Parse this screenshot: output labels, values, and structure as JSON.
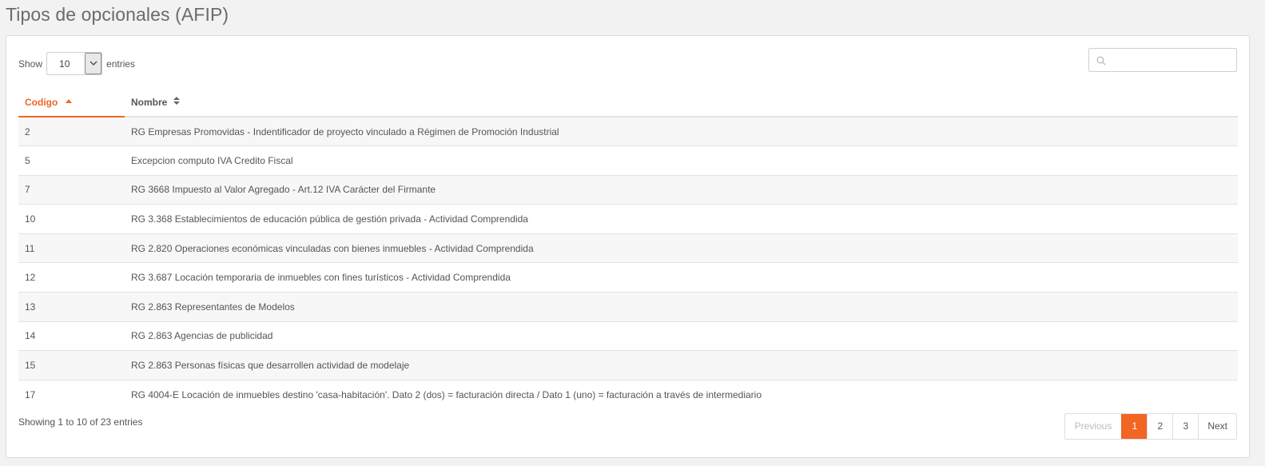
{
  "page": {
    "title": "Tipos de opcionales (AFIP)"
  },
  "length": {
    "show_label": "Show",
    "value": "10",
    "entries_label": "entries"
  },
  "search": {
    "placeholder": ""
  },
  "table": {
    "columns": [
      "Codigo",
      "Nombre"
    ],
    "rows": [
      {
        "codigo": "2",
        "nombre": "RG Empresas Promovidas - Indentificador de proyecto vinculado a Régimen de Promoción Industrial"
      },
      {
        "codigo": "5",
        "nombre": "Excepcion computo IVA Credito Fiscal"
      },
      {
        "codigo": "7",
        "nombre": "RG 3668 Impuesto al Valor Agregado - Art.12 IVA Carácter del Firmante"
      },
      {
        "codigo": "10",
        "nombre": "RG 3.368 Establecimientos de educación pública de gestión privada - Actividad Comprendida"
      },
      {
        "codigo": "11",
        "nombre": "RG 2.820 Operaciones económicas vinculadas con bienes inmuebles - Actividad Comprendida"
      },
      {
        "codigo": "12",
        "nombre": "RG 3.687 Locación temporaria de inmuebles con fines turísticos - Actividad Comprendida"
      },
      {
        "codigo": "13",
        "nombre": "RG 2.863 Representantes de Modelos"
      },
      {
        "codigo": "14",
        "nombre": "RG 2.863 Agencias de publicidad"
      },
      {
        "codigo": "15",
        "nombre": "RG 2.863 Personas físicas que desarrollen actividad de modelaje"
      },
      {
        "codigo": "17",
        "nombre": "RG 4004-E Locación de inmuebles destino 'casa-habitación'. Dato 2 (dos) = facturación directa / Dato 1 (uno) = facturación a través de intermediario"
      }
    ]
  },
  "info": "Showing 1 to 10 of 23 entries",
  "pagination": {
    "previous": "Previous",
    "pages": [
      "1",
      "2",
      "3"
    ],
    "active": "1",
    "next": "Next"
  },
  "colors": {
    "accent": "#f26522"
  }
}
